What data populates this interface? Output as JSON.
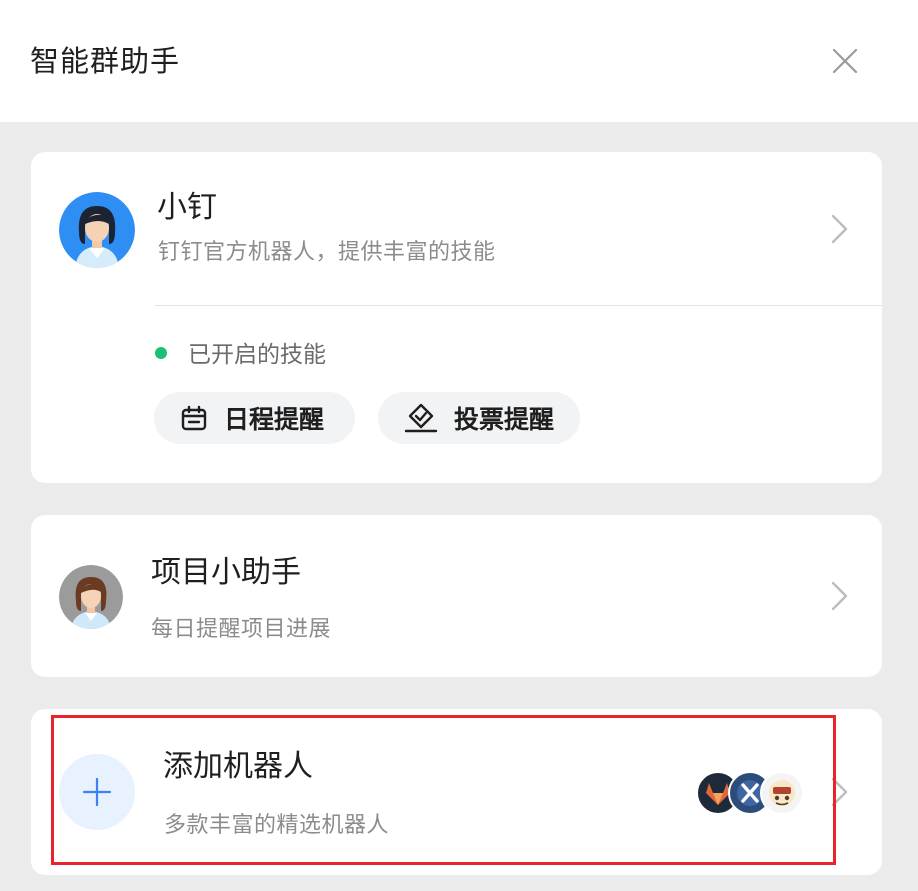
{
  "header": {
    "title": "智能群助手",
    "close_icon": "close-icon"
  },
  "assistants": [
    {
      "name": "小钉",
      "description": "钉钉官方机器人，提供丰富的技能",
      "avatar_icon": "woman-dark-hair-avatar",
      "enabled_skills_label": "已开启的技能",
      "status_color": "#1dbf73",
      "skills": [
        {
          "label": "日程提醒",
          "icon": "calendar-icon"
        },
        {
          "label": "投票提醒",
          "icon": "vote-icon"
        }
      ]
    },
    {
      "name": "项目小助手",
      "description": "每日提醒项目进展",
      "avatar_icon": "woman-brown-hair-avatar"
    }
  ],
  "add_robot": {
    "title": "添加机器人",
    "description": "多款丰富的精选机器人",
    "icon": "plus-icon",
    "preview_icons": [
      "gitlab-bot-icon",
      "jenkins-bot-icon",
      "mascot-bot-icon"
    ]
  },
  "colors": {
    "background": "#ebebeb",
    "accent_blue": "#3b82f6",
    "highlight_red": "#e8232b",
    "status_green": "#1dbf73"
  }
}
